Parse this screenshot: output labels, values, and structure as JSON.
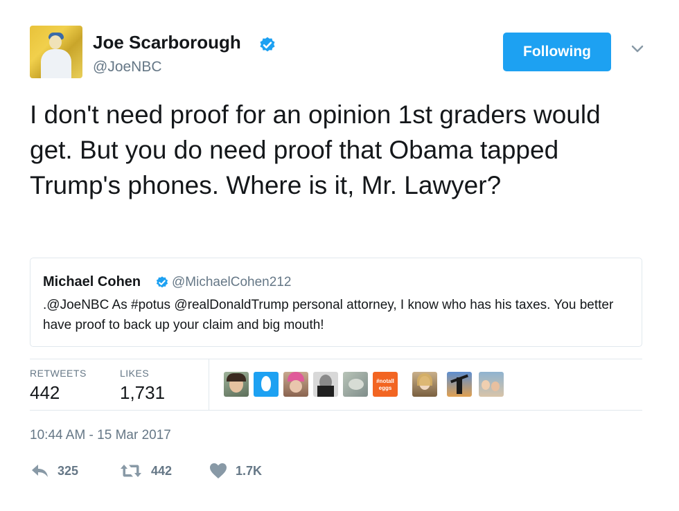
{
  "author": {
    "name": "Joe Scarborough",
    "handle": "@JoeNBC",
    "verified": true
  },
  "follow_button": {
    "label": "Following"
  },
  "tweet": {
    "text": "I don't need proof for an opinion 1st graders would get. But you do need proof that Obama tapped Trump's phones. Where is it, Mr. Lawyer?"
  },
  "quoted": {
    "name": "Michael Cohen",
    "handle": "@MichaelCohen212",
    "text": ".@JoeNBC As #potus @realDonaldTrump personal attorney, I know who has his taxes. You better have proof to back up your claim and big mouth!"
  },
  "stats": {
    "retweets_label": "RETWEETS",
    "retweets_value": "442",
    "likes_label": "LIKES",
    "likes_value": "1,731"
  },
  "timestamp": "10:44 AM - 15 Mar 2017",
  "actions": {
    "reply_count": "325",
    "retweet_count": "442",
    "like_count": "1.7K"
  },
  "liker_avatar_badge": "#notall eggs",
  "colors": {
    "accent": "#1da1f2",
    "text": "#14171a",
    "secondary": "#657786",
    "border": "#e1e8ed"
  }
}
